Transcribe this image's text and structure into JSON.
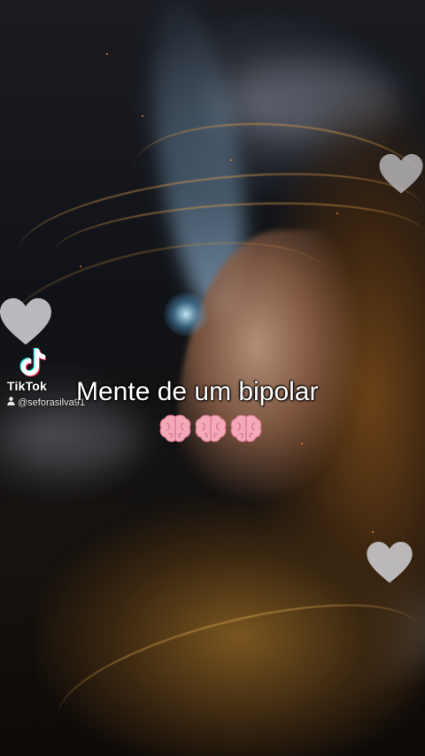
{
  "watermark": {
    "brand": "TikTok",
    "username": "@seforasilva91",
    "icons": [
      "tiktok-logo-icon",
      "user-icon"
    ]
  },
  "caption": {
    "text": "Mente de um bipolar",
    "emojis": [
      "brain-emoji",
      "brain-emoji",
      "brain-emoji"
    ]
  },
  "decor": {
    "hearts": [
      "heart-icon",
      "heart-icon",
      "heart-icon"
    ],
    "heart_color": "#d9d9d9"
  },
  "colors": {
    "caption_text": "#ffffff",
    "hair_accent": "#d6964a",
    "glow": "#bfe9ff"
  }
}
